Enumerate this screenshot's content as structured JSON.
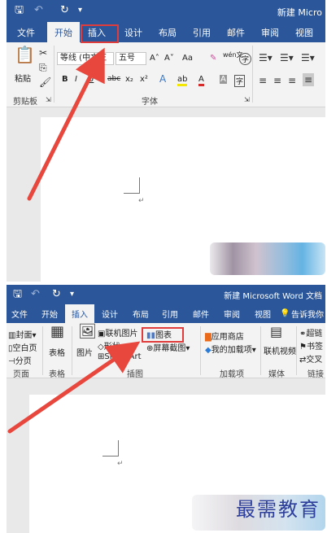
{
  "panel1": {
    "title": "新建 Micro",
    "quick_access": {
      "save_icon": "save-icon",
      "undo_icon": "undo-icon",
      "redo_icon": "redo-icon",
      "customize_icon": "customize-icon"
    },
    "tabs": [
      "文件",
      "开始",
      "插入",
      "设计",
      "布局",
      "引用",
      "邮件",
      "审阅",
      "视图"
    ],
    "active_tab": "开始",
    "clipboard": {
      "paste_label": "粘贴",
      "group_label": "剪贴板"
    },
    "font": {
      "font_name": "等线 (中文正",
      "font_size": "五号",
      "grow_label": "A˄",
      "shrink_label": "A˅",
      "aa_label": "Aa",
      "wen_label": "wén文",
      "circle_label": "字",
      "bold": "B",
      "italic": "I",
      "underline": "U",
      "strike": "abc",
      "subscript": "x₂",
      "superscript": "x²",
      "text_effect": "A",
      "highlight": "ab",
      "font_color": "A",
      "char_shade": "A",
      "char_border": "字",
      "group_label": "字体"
    },
    "paragraph_mark": "↵",
    "highlighted_tab": "插入"
  },
  "panel2": {
    "title": "新建 Microsoft Word 文档",
    "tabs": [
      "文件",
      "开始",
      "插入",
      "设计",
      "布局",
      "引用",
      "邮件",
      "审阅",
      "视图"
    ],
    "tell_me": "告诉我你",
    "active_tab": "插入",
    "pages": {
      "items": [
        "封面",
        "空白页",
        "分页"
      ],
      "group_label": "页面"
    },
    "tables": {
      "label": "表格",
      "group_label": "表格"
    },
    "illustrations": {
      "picture": "图片",
      "online_picture": "联机图片",
      "shapes": "形状",
      "smartart": "SmartArt",
      "chart": "图表",
      "screenshot": "屏幕截图",
      "group_label": "插图"
    },
    "addins": {
      "store": "应用商店",
      "my_addins": "我的加载项",
      "group_label": "加载项"
    },
    "media": {
      "online_video": "联机视频",
      "group_label": "媒体"
    },
    "links": {
      "hyperlink": "超链",
      "bookmark": "书签",
      "cross_ref": "交叉",
      "group_label": "链接"
    },
    "paragraph_mark": "↵"
  },
  "watermark": "最需教育",
  "colors": {
    "ribbon_blue": "#2b579a",
    "highlight_red": "#e03c3c",
    "arrow_red": "#e8473e"
  }
}
